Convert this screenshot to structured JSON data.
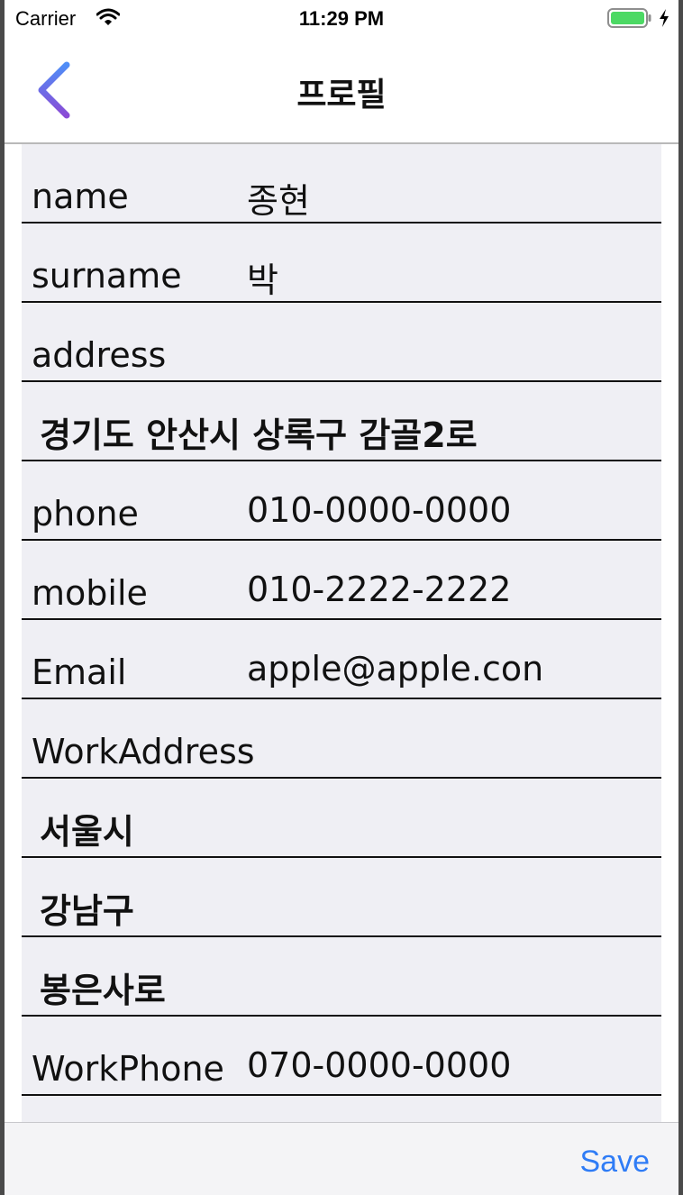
{
  "status_bar": {
    "carrier": "Carrier",
    "time": "11:29 PM"
  },
  "nav": {
    "back_icon": "chevron-left-icon",
    "title": "프로필"
  },
  "fields": [
    {
      "label": "name",
      "value": "종현"
    },
    {
      "label": "surname",
      "value": "박"
    },
    {
      "label": "address",
      "value": ""
    },
    {
      "full": "경기도 안산시 상록구 감골2로"
    },
    {
      "label": "phone",
      "value": "010-0000-0000"
    },
    {
      "label": "mobile",
      "value": "010-2222-2222"
    },
    {
      "label": "Email",
      "value": "apple@apple.con"
    },
    {
      "label": "WorkAddress",
      "value": ""
    },
    {
      "full": "서울시"
    },
    {
      "full": "강남구"
    },
    {
      "full": "봉은사로"
    },
    {
      "label": "WorkPhone",
      "value": "070-0000-0000"
    }
  ],
  "toolbar": {
    "save_label": "Save"
  },
  "colors": {
    "accent": "#2f7cf6",
    "battery": "#4cd964",
    "back_gradient_start": "#4f8ef7",
    "back_gradient_end": "#8a4bd6",
    "form_background": "#efeff4"
  }
}
